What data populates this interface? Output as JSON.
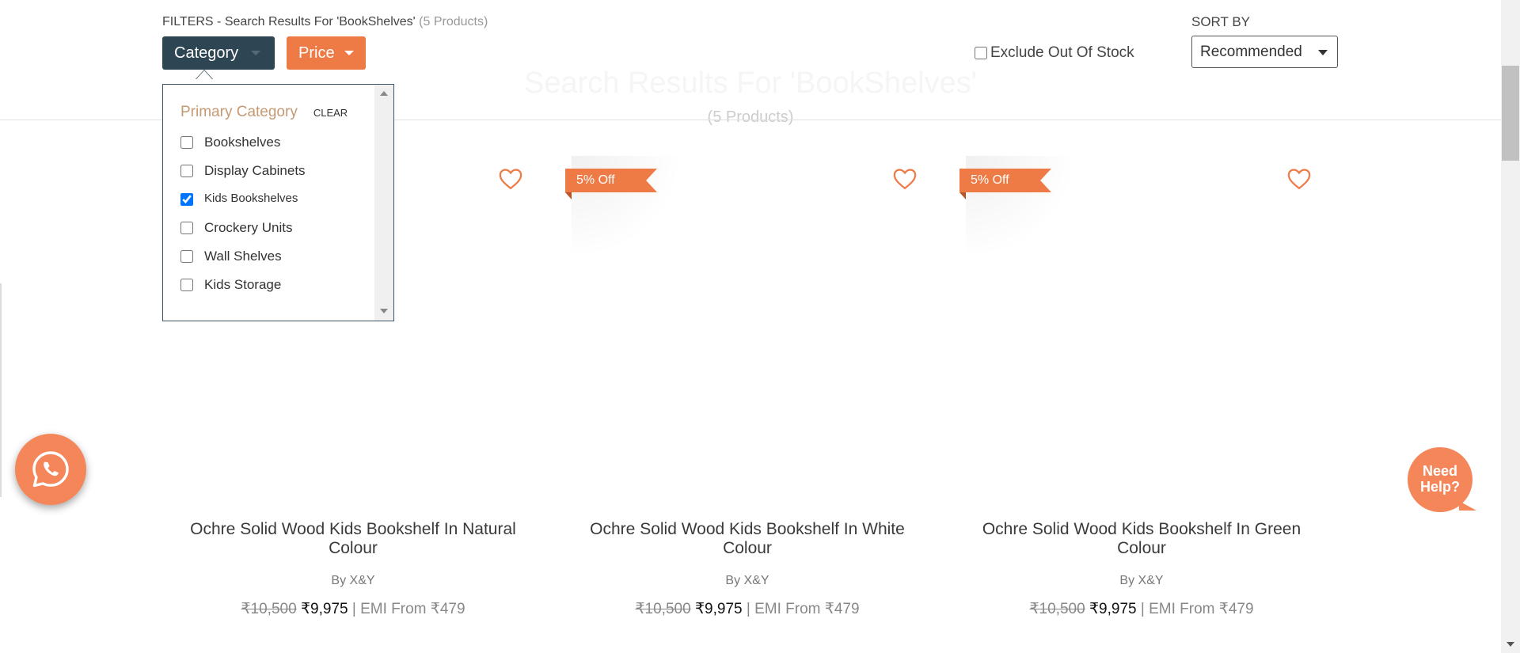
{
  "filters": {
    "title": "FILTERS - Search Results For 'BookShelves'",
    "count": "(5 Products)",
    "category_label": "Category",
    "price_label": "Price",
    "exclude_out_of_stock": "Exclude Out Of Stock",
    "exclude_checked": false,
    "sort_label": "SORT BY",
    "sort_value": "Recommended"
  },
  "background_heading": {
    "title": "Search Results For 'BookShelves'",
    "count": "(5 Products)"
  },
  "category_dropdown": {
    "title": "Primary Category",
    "clear": "CLEAR",
    "options": [
      {
        "label": "Bookshelves",
        "checked": false
      },
      {
        "label": "Display Cabinets",
        "checked": false
      },
      {
        "label": "Kids Bookshelves",
        "checked": true
      },
      {
        "label": "Crockery Units",
        "checked": false
      },
      {
        "label": "Wall Shelves",
        "checked": false
      },
      {
        "label": "Kids Storage",
        "checked": false
      }
    ]
  },
  "products": [
    {
      "name": "Ochre Solid Wood Kids Bookshelf In Natural Colour",
      "brand_prefix": "By",
      "brand": "X&Y",
      "old_price": "₹10,500",
      "price": "₹9,975",
      "emi": "| EMI From ₹479",
      "discount": ""
    },
    {
      "name": "Ochre Solid Wood Kids Bookshelf In White Colour",
      "brand_prefix": "By",
      "brand": "X&Y",
      "old_price": "₹10,500",
      "price": "₹9,975",
      "emi": "| EMI From ₹479",
      "discount": "5% Off"
    },
    {
      "name": "Ochre Solid Wood Kids Bookshelf In Green Colour",
      "brand_prefix": "By",
      "brand": "X&Y",
      "old_price": "₹10,500",
      "price": "₹9,975",
      "emi": "| EMI From ₹479",
      "discount": "5% Off"
    }
  ],
  "widgets": {
    "whatsapp_icon": "whatsapp-icon",
    "need_help_line1": "Need",
    "need_help_line2": "Help?"
  },
  "colors": {
    "accent": "#ee7a45",
    "dark": "#2e4654",
    "category_title": "#c49a72"
  }
}
